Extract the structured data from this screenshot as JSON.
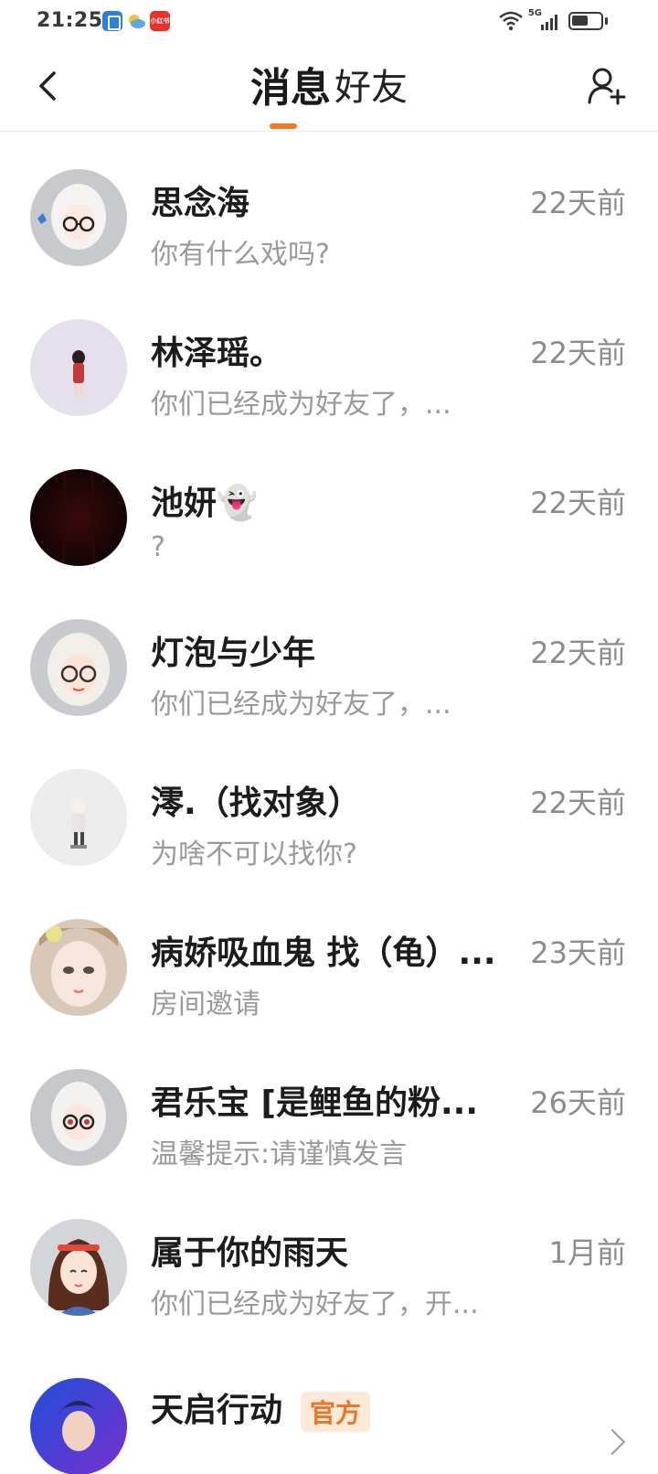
{
  "status_bar": {
    "time": "21:25",
    "app_icon_3_label": "小红书",
    "network": "5G"
  },
  "header": {
    "tabs": [
      {
        "label": "消息",
        "active": true
      },
      {
        "label": "好友",
        "active": false
      }
    ],
    "accent_color": "#f47a1f"
  },
  "conversations": [
    {
      "name": "思念海",
      "time": "22天前",
      "preview": "你有什么戏吗?"
    },
    {
      "name": "林泽瑶。",
      "time": "22天前",
      "preview": "你们已经成为好友了，..."
    },
    {
      "name": "池妍👻",
      "time": "22天前",
      "preview": "?"
    },
    {
      "name": "灯泡与少年",
      "time": "22天前",
      "preview": "你们已经成为好友了，..."
    },
    {
      "name": "澪.（找对象）",
      "time": "22天前",
      "preview": "为啥不可以找你?"
    },
    {
      "name": "病娇吸血鬼 找（龟）...",
      "time": "23天前",
      "preview": "房间邀请"
    },
    {
      "name": "君乐宝 [是鲤鱼的粉...",
      "time": "26天前",
      "preview": "温馨提示:请谨慎发言"
    },
    {
      "name": "属于你的雨天",
      "time": "1月前",
      "preview": "你们已经成为好友了，开..."
    },
    {
      "name": "天启行动",
      "badge": "官方",
      "time": "",
      "preview": ""
    }
  ]
}
